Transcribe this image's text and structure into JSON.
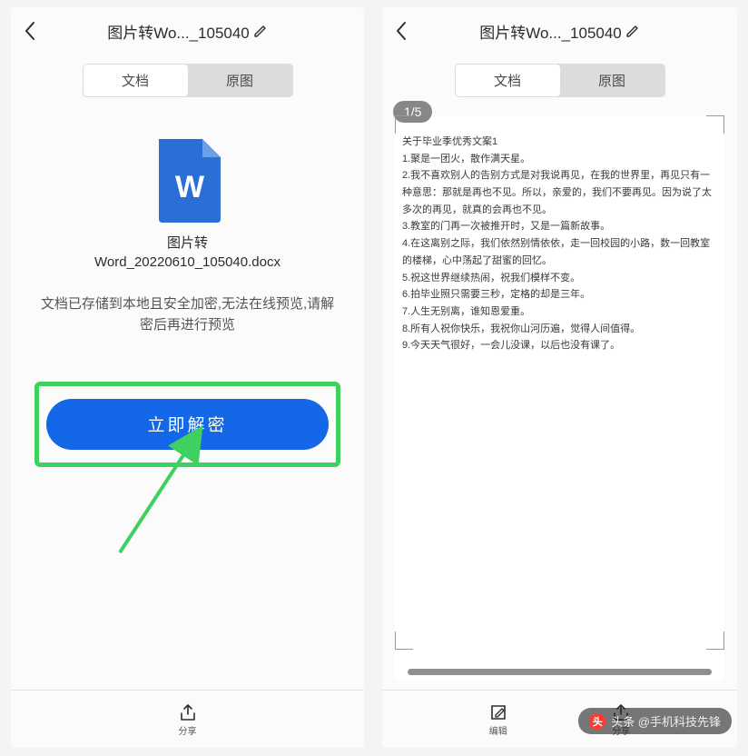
{
  "left": {
    "title": "图片转Wo..._105040",
    "tabs": {
      "doc": "文档",
      "orig": "原图"
    },
    "file": {
      "line1": "图片转",
      "line2": "Word_20220610_105040.docx"
    },
    "msg": {
      "line1": "文档已存储到本地且安全加密,无法在线预览,请解",
      "line2": "密后再进行预览"
    },
    "button": "立即解密",
    "bottom": {
      "share": "分享"
    }
  },
  "right": {
    "title": "图片转Wo..._105040",
    "tabs": {
      "doc": "文档",
      "orig": "原图"
    },
    "badge": "1/5",
    "lines": [
      "关于毕业季优秀文案1",
      "1.聚是一团火，散作满天星。",
      "2.我不喜欢别人的告别方式是对我说再见，在我的世界里，再见只有一种意思：那就是再也不见。所以，亲爱的，我们不要再见。因为说了太多次的再见，就真的会再也不见。",
      "3.教室的门再一次被推开时，又是一篇新故事。",
      "4.在这离别之际，我们依然别情依依，走一回校园的小路，数一回教室的楼梯，心中荡起了甜蜜的回忆。",
      "5.祝这世界继续热闹，祝我们模样不变。",
      "6.拍毕业照只需要三秒，定格的却是三年。",
      "7.人生无别离，谁知恩爱重。",
      "8.所有人祝你快乐，我祝你山河历遍，觉得人间值得。",
      "9.今天天气很好，一会儿没课，以后也没有课了。"
    ],
    "bottom": {
      "edit": "编辑",
      "share": "分享"
    }
  },
  "watermark": "头条 @手机科技先锋"
}
